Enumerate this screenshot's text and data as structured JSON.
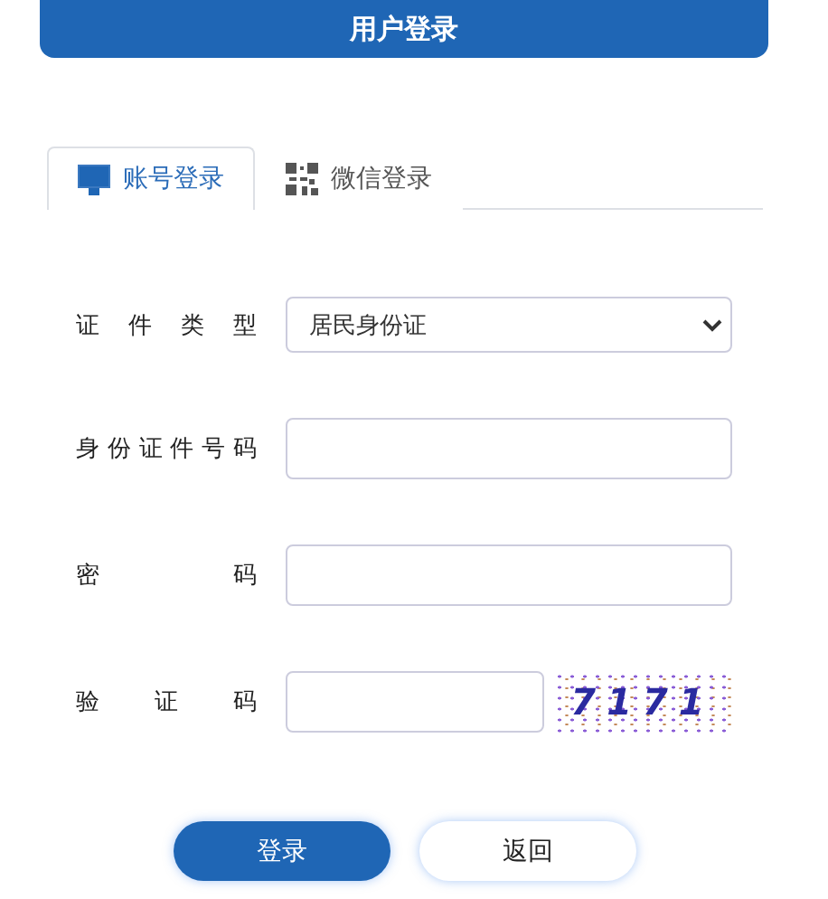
{
  "header": {
    "title": "用户登录"
  },
  "tabs": [
    {
      "label": "账号登录",
      "selected": true
    },
    {
      "label": "微信登录",
      "selected": false
    }
  ],
  "form": {
    "rows": [
      {
        "kind": "select",
        "label": "证件类型",
        "value": "居民身份证"
      },
      {
        "kind": "input",
        "label": "身份证件号码"
      },
      {
        "kind": "password",
        "label": "密码"
      },
      {
        "kind": "captcha",
        "label": "验证码",
        "code": "7171"
      }
    ]
  },
  "buttons": [
    {
      "label": "登录",
      "kind": "primary"
    },
    {
      "label": "返回",
      "kind": "secondary"
    }
  ]
}
